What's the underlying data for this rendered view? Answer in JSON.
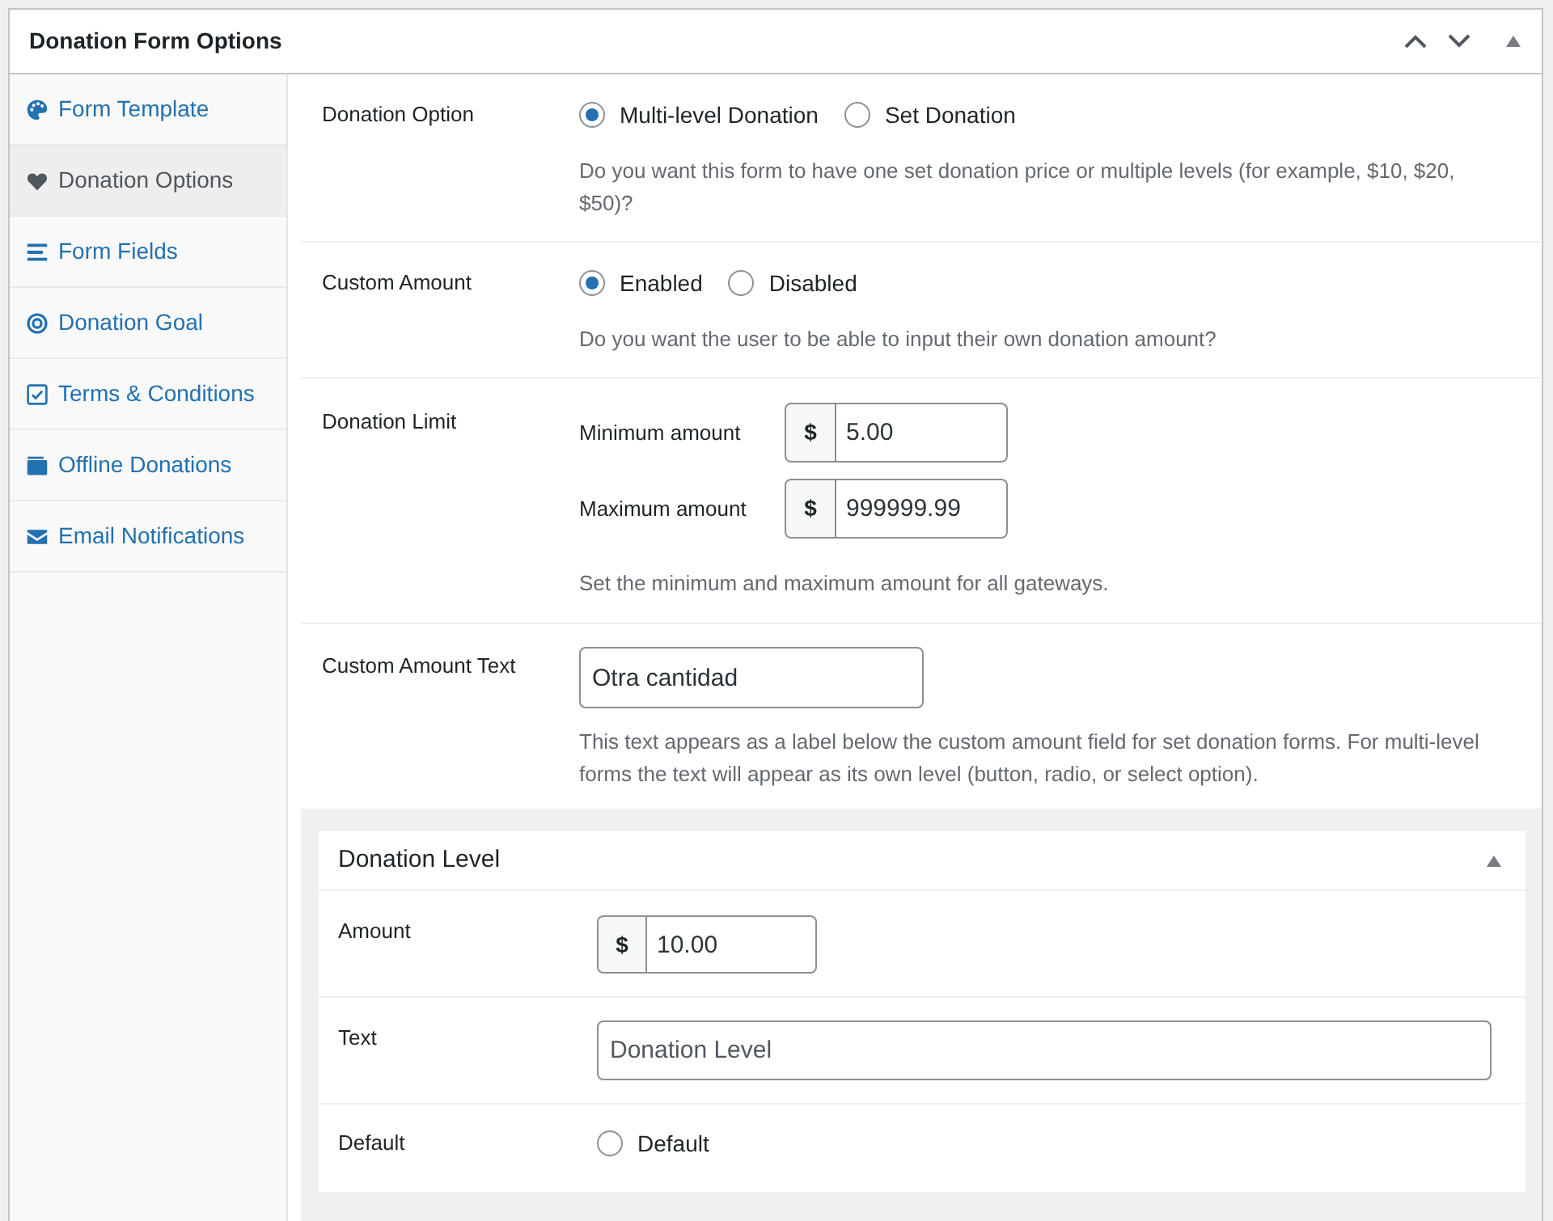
{
  "panel": {
    "title": "Donation Form Options"
  },
  "sidebar": {
    "items": [
      {
        "label": "Form Template",
        "selected": false
      },
      {
        "label": "Donation Options",
        "selected": true
      },
      {
        "label": "Form Fields",
        "selected": false
      },
      {
        "label": "Donation Goal",
        "selected": false
      },
      {
        "label": "Terms & Conditions",
        "selected": false
      },
      {
        "label": "Offline Donations",
        "selected": false
      },
      {
        "label": "Email Notifications",
        "selected": false
      }
    ]
  },
  "fields": [
    {
      "kind": "radio_group",
      "label": "Donation Option",
      "options": [
        {
          "label": "Multi-level Donation",
          "selected": true
        },
        {
          "label": "Set Donation",
          "selected": false
        }
      ],
      "description": "Do you want this form to have one set donation price or multiple levels (for example, $10, $20, $50)?"
    },
    {
      "kind": "radio_group",
      "label": "Custom Amount",
      "options": [
        {
          "label": "Enabled",
          "selected": true
        },
        {
          "label": "Disabled",
          "selected": false
        }
      ],
      "description": "Do you want the user to be able to input their own donation amount?"
    },
    {
      "kind": "amount_range",
      "label": "Donation Limit",
      "inputs": [
        {
          "label": "Minimum amount",
          "currency": "$",
          "value": "5.00"
        },
        {
          "label": "Maximum amount",
          "currency": "$",
          "value": "999999.99"
        }
      ],
      "description": "Set the minimum and maximum amount for all gateways."
    },
    {
      "kind": "text",
      "label": "Custom Amount Text",
      "value": "Otra cantidad",
      "description": "This text appears as a label below the custom amount field for set donation forms. For multi-level forms the text will appear as its own level (button, radio, or select option)."
    }
  ],
  "donation_level": {
    "title": "Donation Level",
    "fields": [
      {
        "kind": "amount",
        "label": "Amount",
        "currency": "$",
        "value": "10.00"
      },
      {
        "kind": "text",
        "label": "Text",
        "placeholder": "Donation Level"
      },
      {
        "kind": "radio",
        "label": "Default",
        "option": {
          "label": "Default",
          "selected": false
        }
      }
    ]
  }
}
